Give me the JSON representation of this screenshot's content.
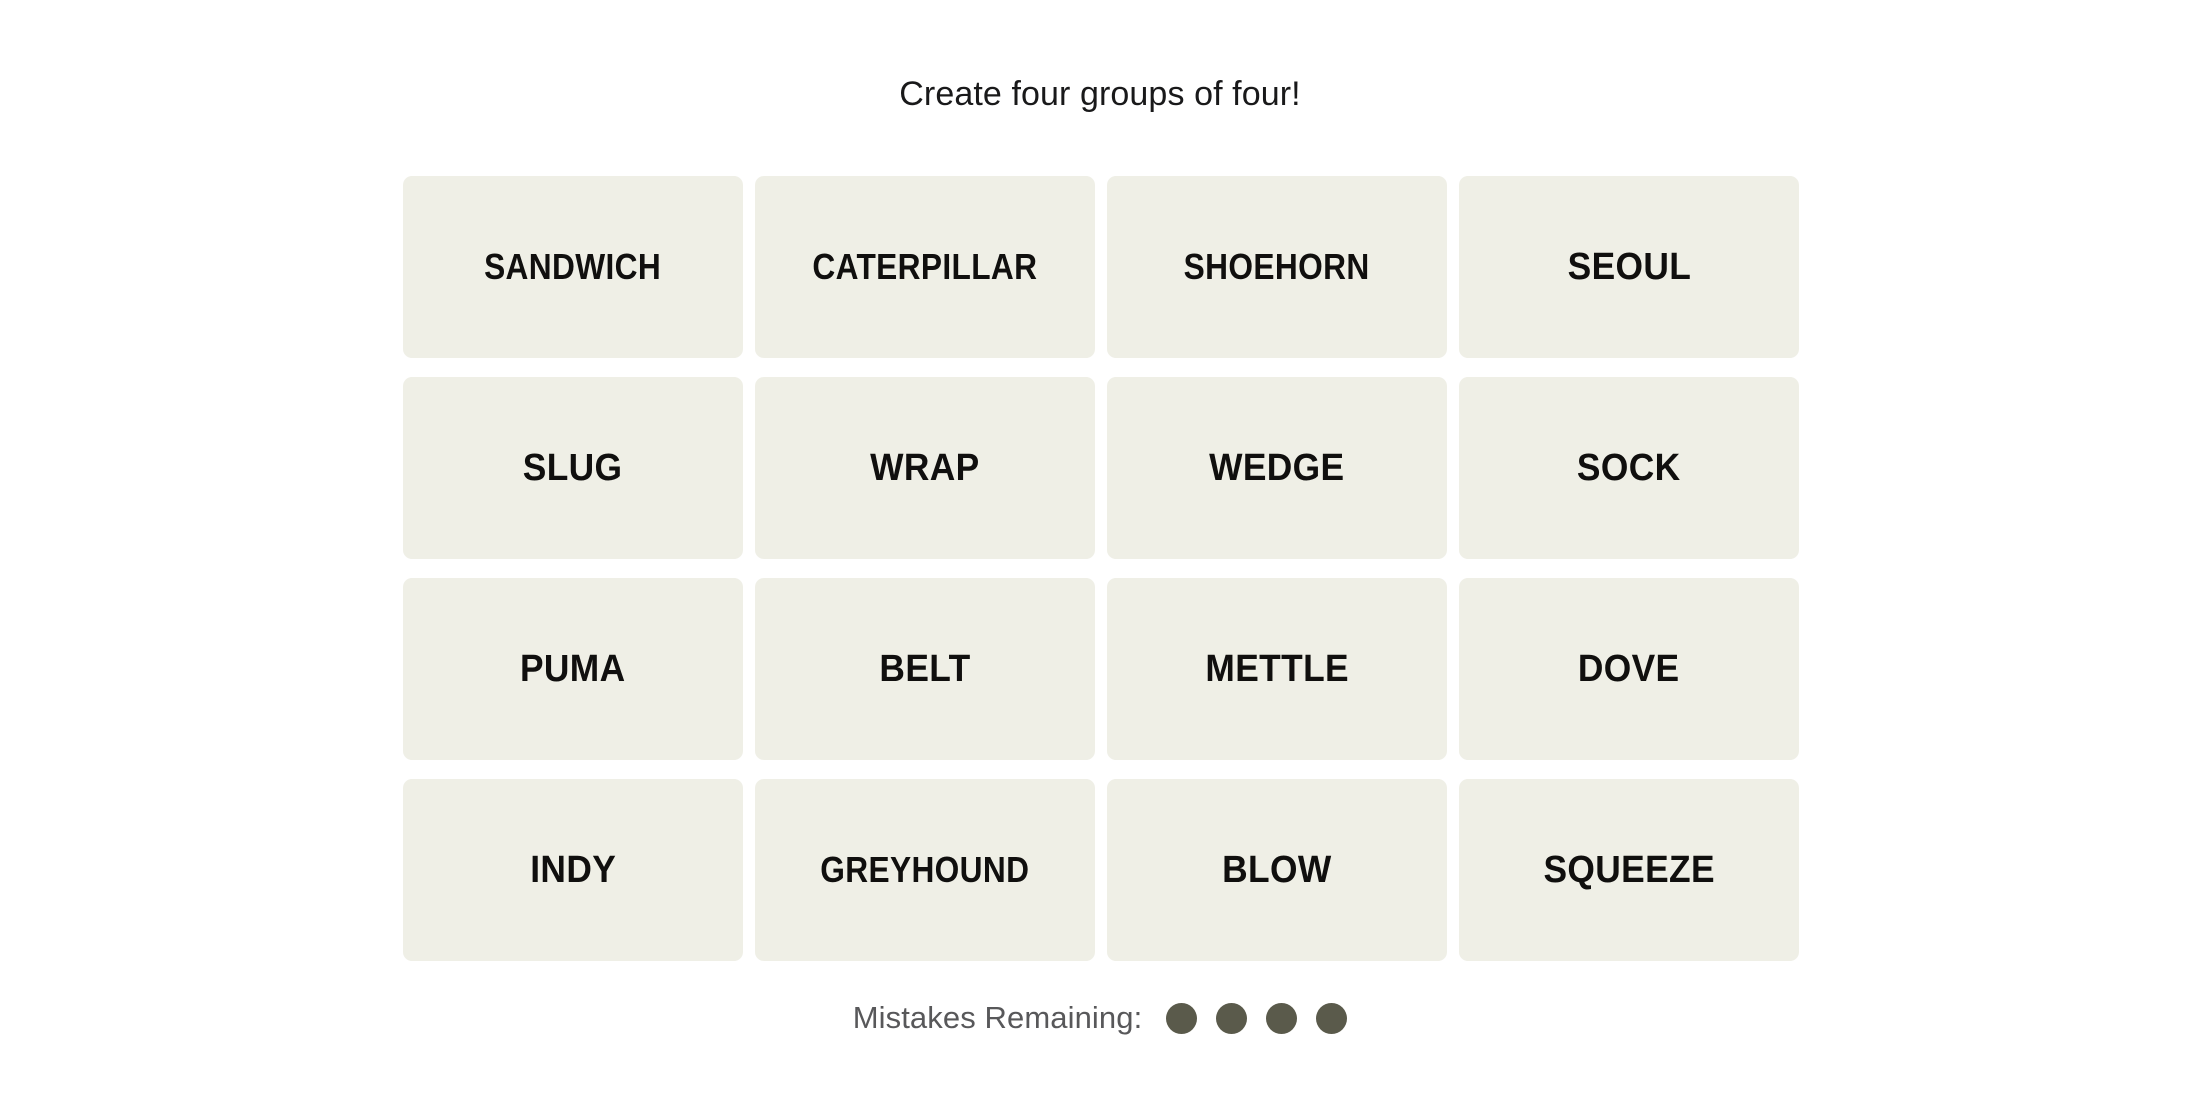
{
  "page": {
    "background_color": "#ffffff"
  },
  "header": {
    "instruction": "Create four groups of four!"
  },
  "board": {
    "rows": 4,
    "columns": 4,
    "tile_color": "#efefe6",
    "tile_text_color": "#100f0e",
    "tiles": [
      {
        "label": "SANDWICH",
        "selected": false,
        "long": true
      },
      {
        "label": "CATERPILLAR",
        "selected": false,
        "long": true
      },
      {
        "label": "SHOEHORN",
        "selected": false,
        "long": true
      },
      {
        "label": "SEOUL",
        "selected": false,
        "long": false
      },
      {
        "label": "SLUG",
        "selected": false,
        "long": false
      },
      {
        "label": "WRAP",
        "selected": false,
        "long": false
      },
      {
        "label": "WEDGE",
        "selected": false,
        "long": false
      },
      {
        "label": "SOCK",
        "selected": false,
        "long": false
      },
      {
        "label": "PUMA",
        "selected": false,
        "long": false
      },
      {
        "label": "BELT",
        "selected": false,
        "long": false
      },
      {
        "label": "METTLE",
        "selected": false,
        "long": false
      },
      {
        "label": "DOVE",
        "selected": false,
        "long": false
      },
      {
        "label": "INDY",
        "selected": false,
        "long": false
      },
      {
        "label": "GREYHOUND",
        "selected": false,
        "long": true
      },
      {
        "label": "BLOW",
        "selected": false,
        "long": false
      },
      {
        "label": "SQUEEZE",
        "selected": false,
        "long": false
      }
    ]
  },
  "footer": {
    "mistakes_label": "Mistakes Remaining:",
    "mistakes_remaining": 4,
    "dot_color": "#5a5a4b",
    "label_color": "#58585a"
  }
}
